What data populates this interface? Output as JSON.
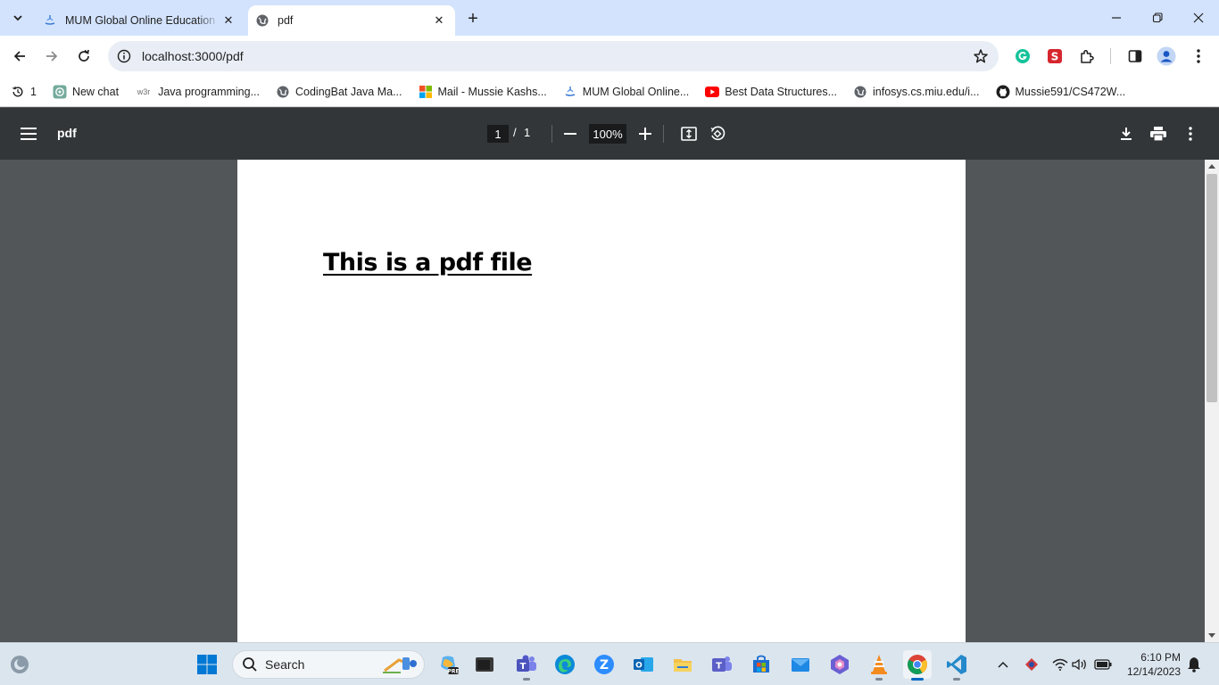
{
  "tabs": [
    {
      "title": "MUM Global Online Education",
      "active": false
    },
    {
      "title": "pdf",
      "active": true
    }
  ],
  "address_bar": {
    "url": "localhost:3000/pdf"
  },
  "bookmarks": [
    {
      "label": "1",
      "icon": "history-icon"
    },
    {
      "label": "New chat",
      "icon": "openai-icon"
    },
    {
      "label": "Java programming...",
      "icon": "w3schools-icon"
    },
    {
      "label": "CodingBat Java Ma...",
      "icon": "globe-icon"
    },
    {
      "label": "Mail - Mussie Kashs...",
      "icon": "microsoft-icon"
    },
    {
      "label": "MUM Global Online...",
      "icon": "mum-icon"
    },
    {
      "label": "Best Data Structures...",
      "icon": "youtube-icon"
    },
    {
      "label": "infosys.cs.miu.edu/i...",
      "icon": "globe-icon"
    },
    {
      "label": "Mussie591/CS472W...",
      "icon": "github-icon"
    }
  ],
  "pdf_viewer": {
    "title": "pdf",
    "current_page": "1",
    "separator": "/",
    "total_pages": "1",
    "zoom": "100%"
  },
  "document": {
    "heading": "This is a pdf file"
  },
  "taskbar": {
    "search_placeholder": "Search",
    "time": "6:10 PM",
    "date": "12/14/2023"
  },
  "colors": {
    "tabstrip": "#d3e3fd",
    "pdf_toolbar": "#323639",
    "viewer_bg": "#525659",
    "taskbar": "#dbe5ee"
  }
}
